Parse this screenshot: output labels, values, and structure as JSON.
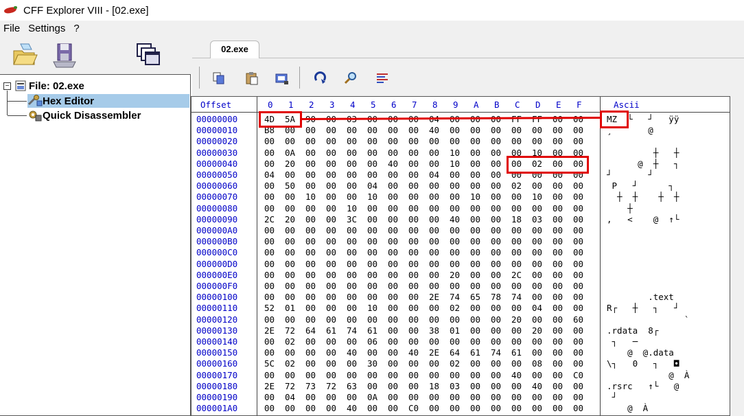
{
  "window": {
    "title": "CFF Explorer VIII - [02.exe]"
  },
  "menu": [
    "File",
    "Settings",
    "?"
  ],
  "tree": {
    "root": "File: 02.exe",
    "children": [
      "Hex Editor",
      "Quick Disassembler"
    ],
    "selected": "Hex Editor"
  },
  "tab": {
    "label": "02.exe"
  },
  "hex": {
    "offset_header": "Offset",
    "column_headers": [
      "0",
      "1",
      "2",
      "3",
      "4",
      "5",
      "6",
      "7",
      "8",
      "9",
      "A",
      "B",
      "C",
      "D",
      "E",
      "F"
    ],
    "ascii_header": "Ascii",
    "rows": [
      {
        "offset": "00000000",
        "bytes": [
          "4D",
          "5A",
          "90",
          "00",
          "03",
          "00",
          "00",
          "00",
          "04",
          "00",
          "00",
          "00",
          "FF",
          "FF",
          "00",
          "00"
        ],
        "ascii": "MZ  └   ┘   ÿÿ  "
      },
      {
        "offset": "00000010",
        "bytes": [
          "B8",
          "00",
          "00",
          "00",
          "00",
          "00",
          "00",
          "00",
          "40",
          "00",
          "00",
          "00",
          "00",
          "00",
          "00",
          "00"
        ],
        "ascii": "¸       @       "
      },
      {
        "offset": "00000020",
        "bytes": [
          "00",
          "00",
          "00",
          "00",
          "00",
          "00",
          "00",
          "00",
          "00",
          "00",
          "00",
          "00",
          "00",
          "00",
          "00",
          "00"
        ],
        "ascii": "                "
      },
      {
        "offset": "00000030",
        "bytes": [
          "00",
          "0A",
          "00",
          "00",
          "00",
          "00",
          "00",
          "00",
          "00",
          "10",
          "00",
          "00",
          "00",
          "10",
          "00",
          "00"
        ],
        "ascii": "         ┼   ┼  "
      },
      {
        "offset": "00000040",
        "bytes": [
          "00",
          "20",
          "00",
          "00",
          "00",
          "00",
          "40",
          "00",
          "00",
          "10",
          "00",
          "00",
          "00",
          "02",
          "00",
          "00"
        ],
        "ascii": "      @  ┼   ┐  "
      },
      {
        "offset": "00000050",
        "bytes": [
          "04",
          "00",
          "00",
          "00",
          "00",
          "00",
          "00",
          "00",
          "04",
          "00",
          "00",
          "00",
          "00",
          "00",
          "00",
          "00"
        ],
        "ascii": "┘       ┘       "
      },
      {
        "offset": "00000060",
        "bytes": [
          "00",
          "50",
          "00",
          "00",
          "00",
          "04",
          "00",
          "00",
          "00",
          "00",
          "00",
          "00",
          "02",
          "00",
          "00",
          "00"
        ],
        "ascii": " P   ┘      ┐   "
      },
      {
        "offset": "00000070",
        "bytes": [
          "00",
          "00",
          "10",
          "00",
          "00",
          "10",
          "00",
          "00",
          "00",
          "00",
          "10",
          "00",
          "00",
          "10",
          "00",
          "00"
        ],
        "ascii": "  ┼  ┼    ┼  ┼  "
      },
      {
        "offset": "00000080",
        "bytes": [
          "00",
          "00",
          "00",
          "00",
          "10",
          "00",
          "00",
          "00",
          "00",
          "00",
          "00",
          "00",
          "00",
          "00",
          "00",
          "00"
        ],
        "ascii": "    ┼           "
      },
      {
        "offset": "00000090",
        "bytes": [
          "2C",
          "20",
          "00",
          "00",
          "3C",
          "00",
          "00",
          "00",
          "00",
          "40",
          "00",
          "00",
          "18",
          "03",
          "00",
          "00"
        ],
        "ascii": ",   <    @  ↑└  "
      },
      {
        "offset": "000000A0",
        "bytes": [
          "00",
          "00",
          "00",
          "00",
          "00",
          "00",
          "00",
          "00",
          "00",
          "00",
          "00",
          "00",
          "00",
          "00",
          "00",
          "00"
        ],
        "ascii": "                "
      },
      {
        "offset": "000000B0",
        "bytes": [
          "00",
          "00",
          "00",
          "00",
          "00",
          "00",
          "00",
          "00",
          "00",
          "00",
          "00",
          "00",
          "00",
          "00",
          "00",
          "00"
        ],
        "ascii": "                "
      },
      {
        "offset": "000000C0",
        "bytes": [
          "00",
          "00",
          "00",
          "00",
          "00",
          "00",
          "00",
          "00",
          "00",
          "00",
          "00",
          "00",
          "00",
          "00",
          "00",
          "00"
        ],
        "ascii": "                "
      },
      {
        "offset": "000000D0",
        "bytes": [
          "00",
          "00",
          "00",
          "00",
          "00",
          "00",
          "00",
          "00",
          "00",
          "00",
          "00",
          "00",
          "00",
          "00",
          "00",
          "00"
        ],
        "ascii": "                "
      },
      {
        "offset": "000000E0",
        "bytes": [
          "00",
          "00",
          "00",
          "00",
          "00",
          "00",
          "00",
          "00",
          "00",
          "20",
          "00",
          "00",
          "2C",
          "00",
          "00",
          "00"
        ],
        "ascii": "                "
      },
      {
        "offset": "000000F0",
        "bytes": [
          "00",
          "00",
          "00",
          "00",
          "00",
          "00",
          "00",
          "00",
          "00",
          "00",
          "00",
          "00",
          "00",
          "00",
          "00",
          "00"
        ],
        "ascii": "                "
      },
      {
        "offset": "00000100",
        "bytes": [
          "00",
          "00",
          "00",
          "00",
          "00",
          "00",
          "00",
          "00",
          "2E",
          "74",
          "65",
          "78",
          "74",
          "00",
          "00",
          "00"
        ],
        "ascii": "        .text   "
      },
      {
        "offset": "00000110",
        "bytes": [
          "52",
          "01",
          "00",
          "00",
          "00",
          "10",
          "00",
          "00",
          "00",
          "02",
          "00",
          "00",
          "00",
          "04",
          "00",
          "00"
        ],
        "ascii": "R┌   ┼   ┐   ┘  "
      },
      {
        "offset": "00000120",
        "bytes": [
          "00",
          "00",
          "00",
          "00",
          "00",
          "00",
          "00",
          "00",
          "00",
          "00",
          "00",
          "00",
          "20",
          "00",
          "00",
          "60"
        ],
        "ascii": "               `"
      },
      {
        "offset": "00000130",
        "bytes": [
          "2E",
          "72",
          "64",
          "61",
          "74",
          "61",
          "00",
          "00",
          "38",
          "01",
          "00",
          "00",
          "00",
          "20",
          "00",
          "00"
        ],
        "ascii": ".rdata  8┌      "
      },
      {
        "offset": "00000140",
        "bytes": [
          "00",
          "02",
          "00",
          "00",
          "00",
          "06",
          "00",
          "00",
          "00",
          "00",
          "00",
          "00",
          "00",
          "00",
          "00",
          "00"
        ],
        "ascii": " ┐   ─          "
      },
      {
        "offset": "00000150",
        "bytes": [
          "00",
          "00",
          "00",
          "00",
          "40",
          "00",
          "00",
          "40",
          "2E",
          "64",
          "61",
          "74",
          "61",
          "00",
          "00",
          "00"
        ],
        "ascii": "    @  @.data   "
      },
      {
        "offset": "00000160",
        "bytes": [
          "5C",
          "02",
          "00",
          "00",
          "00",
          "30",
          "00",
          "00",
          "00",
          "02",
          "00",
          "00",
          "00",
          "08",
          "00",
          "00"
        ],
        "ascii": "\\┐   0   ┐   ◘  "
      },
      {
        "offset": "00000170",
        "bytes": [
          "00",
          "00",
          "00",
          "00",
          "00",
          "00",
          "00",
          "00",
          "00",
          "00",
          "00",
          "00",
          "40",
          "00",
          "00",
          "C0"
        ],
        "ascii": "            @  À"
      },
      {
        "offset": "00000180",
        "bytes": [
          "2E",
          "72",
          "73",
          "72",
          "63",
          "00",
          "00",
          "00",
          "18",
          "03",
          "00",
          "00",
          "00",
          "40",
          "00",
          "00"
        ],
        "ascii": ".rsrc   ↑└   @  "
      },
      {
        "offset": "00000190",
        "bytes": [
          "00",
          "04",
          "00",
          "00",
          "00",
          "0A",
          "00",
          "00",
          "00",
          "00",
          "00",
          "00",
          "00",
          "00",
          "00",
          "00"
        ],
        "ascii": " ┘              "
      },
      {
        "offset": "000001A0",
        "bytes": [
          "00",
          "00",
          "00",
          "00",
          "40",
          "00",
          "00",
          "C0",
          "00",
          "00",
          "00",
          "00",
          "00",
          "00",
          "00",
          "00"
        ],
        "ascii": "    @  À        "
      }
    ]
  },
  "colors": {
    "accent": "#0000c8",
    "highlight": "#e00000",
    "selection": "#a6cbe9"
  }
}
